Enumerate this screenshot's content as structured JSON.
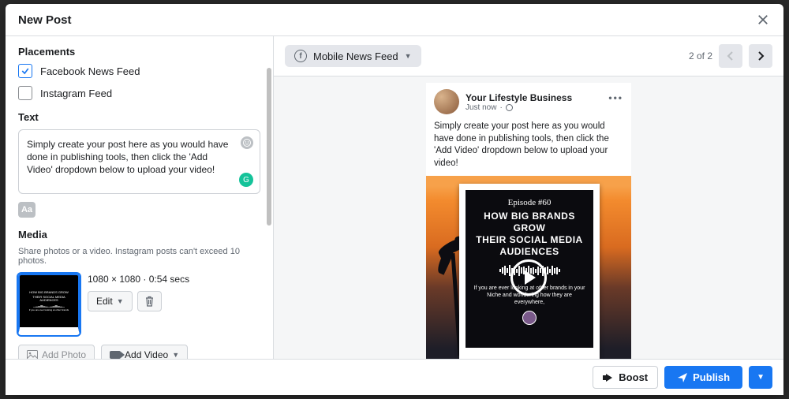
{
  "modal": {
    "title": "New Post"
  },
  "placements": {
    "label": "Placements",
    "options": [
      {
        "label": "Facebook News Feed",
        "checked": true
      },
      {
        "label": "Instagram Feed",
        "checked": false
      }
    ]
  },
  "text": {
    "label": "Text",
    "content": "Simply create your post here as you would have done in publishing tools, then click the 'Add Video' dropdown below to upload your video!"
  },
  "media": {
    "label": "Media",
    "hint": "Share photos or a video. Instagram posts can't exceed 10 photos.",
    "dimensions": "1080 × 1080 · 0:54 secs",
    "edit_label": "Edit",
    "add_photo_label": "Add Photo",
    "add_video_label": "Add Video"
  },
  "preview": {
    "placement_label": "Mobile News Feed",
    "page_counter": "2 of 2",
    "post": {
      "page_name": "Your Lifestyle Business",
      "timestamp": "Just now",
      "body": "Simply create your post here as you would have done in publishing tools, then click the 'Add Video' dropdown below to upload your video!",
      "episode": "Episode #60",
      "headline1": "HOW BIG BRANDS GROW",
      "headline2": "THEIR SOCIAL MEDIA AUDIENCES",
      "subline": "If you are ever looking at other brands in your Niche and wondering how they are everywhere,"
    }
  },
  "footer": {
    "boost_label": "Boost",
    "publish_label": "Publish"
  }
}
